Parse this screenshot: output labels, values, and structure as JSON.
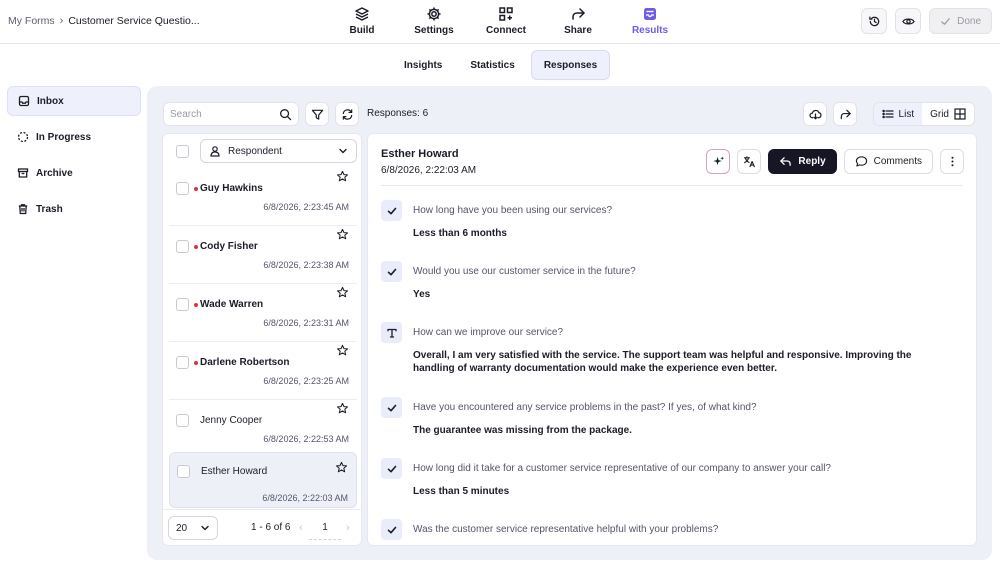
{
  "breadcrumb": {
    "root": "My Forms",
    "separator": "›",
    "current": "Customer Service Questio..."
  },
  "nav": [
    {
      "label": "Build",
      "icon": "layers-icon"
    },
    {
      "label": "Settings",
      "icon": "gear-icon"
    },
    {
      "label": "Connect",
      "icon": "connect-grid-icon"
    },
    {
      "label": "Share",
      "icon": "share-arrow-icon"
    },
    {
      "label": "Results",
      "icon": "inbox-icon",
      "active": true
    }
  ],
  "top_actions": {
    "done_label": "Done"
  },
  "subtabs": [
    {
      "label": "Insights"
    },
    {
      "label": "Statistics"
    },
    {
      "label": "Responses",
      "active": true
    }
  ],
  "sidebar": {
    "items": [
      {
        "label": "Inbox",
        "icon": "inbox-icon",
        "active": true
      },
      {
        "label": "In Progress",
        "icon": "dashed-circle-icon"
      },
      {
        "label": "Archive",
        "icon": "archive-icon"
      },
      {
        "label": "Trash",
        "icon": "trash-icon"
      }
    ]
  },
  "toolbar": {
    "search_placeholder": "Search",
    "responses_count": "Responses: 6",
    "view_list": "List",
    "view_grid": "Grid"
  },
  "list": {
    "filter_label": "Respondent",
    "rows": [
      {
        "name": "Guy Hawkins",
        "time": "6/8/2026, 2:23:45 AM",
        "unread": true
      },
      {
        "name": "Cody Fisher",
        "time": "6/8/2026, 2:23:38 AM",
        "unread": true
      },
      {
        "name": "Wade Warren",
        "time": "6/8/2026, 2:23:31 AM",
        "unread": true
      },
      {
        "name": "Darlene Robertson",
        "time": "6/8/2026, 2:23:25 AM",
        "unread": true
      },
      {
        "name": "Jenny Cooper",
        "time": "6/8/2026, 2:22:53 AM",
        "unread": false
      },
      {
        "name": "Esther Howard",
        "time": "6/8/2026, 2:22:03 AM",
        "unread": false,
        "selected": true
      }
    ],
    "pager": {
      "per_page": "20",
      "range": "1 - 6 of 6",
      "page": "1",
      "prev": "‹",
      "next": "›"
    }
  },
  "detail": {
    "name": "Esther Howard",
    "date": "6/8/2026, 2:22:03 AM",
    "reply_label": "Reply",
    "comments_label": "Comments",
    "answers": [
      {
        "type": "check",
        "question": "How long have you been using our services?",
        "answer": "Less than 6 months"
      },
      {
        "type": "check",
        "question": "Would you use our customer service in the future?",
        "answer": "Yes"
      },
      {
        "type": "text",
        "question": "How can we improve our service?",
        "answer": "Overall, I am very satisfied with the service. The support team was helpful and responsive. Improving the handling of warranty documentation would make the experience even better."
      },
      {
        "type": "check",
        "question": "Have you encountered any service problems in the past? If yes, of what kind?",
        "answer": "The guarantee was missing from the package."
      },
      {
        "type": "check",
        "question": "How long did it take for a customer service representative of our company to answer your call?",
        "answer": "Less than 5 minutes"
      },
      {
        "type": "check",
        "question": "Was the customer service representative helpful with your problems?",
        "answer": ""
      }
    ]
  },
  "colors": {
    "accent": "#6c5ce7",
    "panel_bg": "#eef0f8",
    "reply_bg": "#161625",
    "unread_dot": "#e0303a"
  }
}
